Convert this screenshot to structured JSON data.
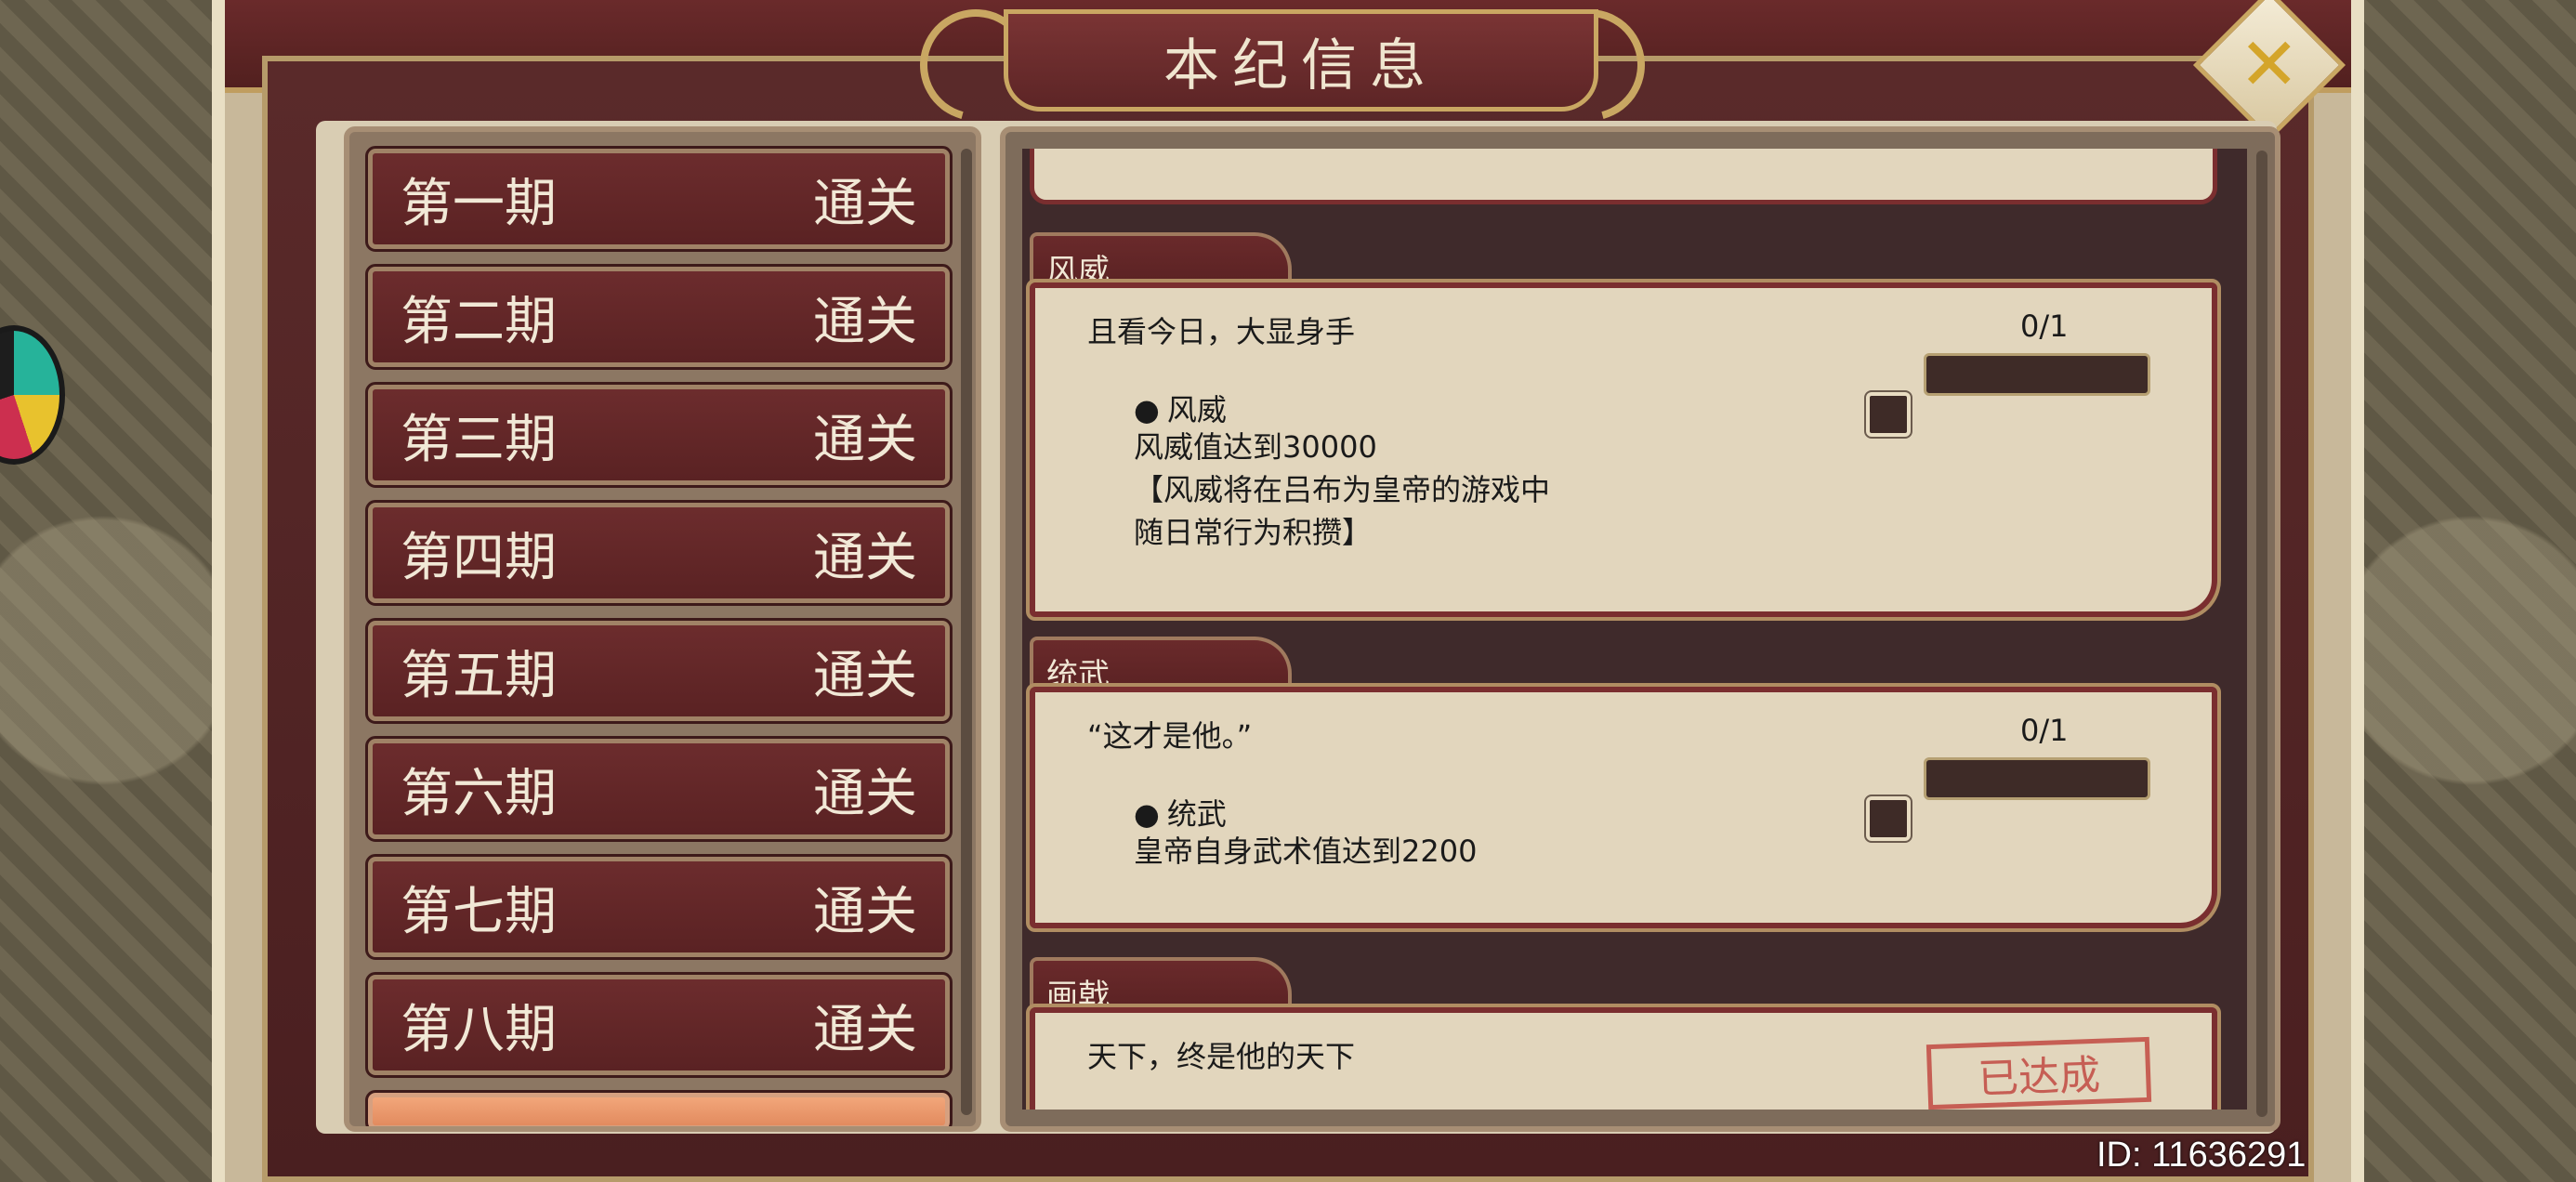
{
  "window": {
    "title": "本纪信息",
    "close_icon": "✕"
  },
  "list": {
    "items": [
      {
        "name": "第一期",
        "status": "通关"
      },
      {
        "name": "第二期",
        "status": "通关"
      },
      {
        "name": "第三期",
        "status": "通关"
      },
      {
        "name": "第四期",
        "status": "通关"
      },
      {
        "name": "第五期",
        "status": "通关"
      },
      {
        "name": "第六期",
        "status": "通关"
      },
      {
        "name": "第七期",
        "status": "通关"
      },
      {
        "name": "第八期",
        "status": "通关"
      }
    ]
  },
  "sections": [
    {
      "tab": "风威",
      "quote": "且看今日，大显身手",
      "progress": "0/1",
      "bullet": "风威",
      "desc": "风威值达到30000\n【风威将在吕布为皇帝的游戏中\n随日常行为积攒】"
    },
    {
      "tab": "统武",
      "quote": "“这才是他。”",
      "progress": "0/1",
      "bullet": "统武",
      "desc": "皇帝自身武术值达到2200"
    },
    {
      "tab": "画戟",
      "quote": "天下，终是他的天下",
      "stamp": "已达成"
    }
  ],
  "footer": {
    "id_text": "ID: 11636291"
  },
  "colors": {
    "panel_maroon": "#5a2223",
    "gold_trim": "#c9a762",
    "parchment": "#e2d6bd"
  }
}
